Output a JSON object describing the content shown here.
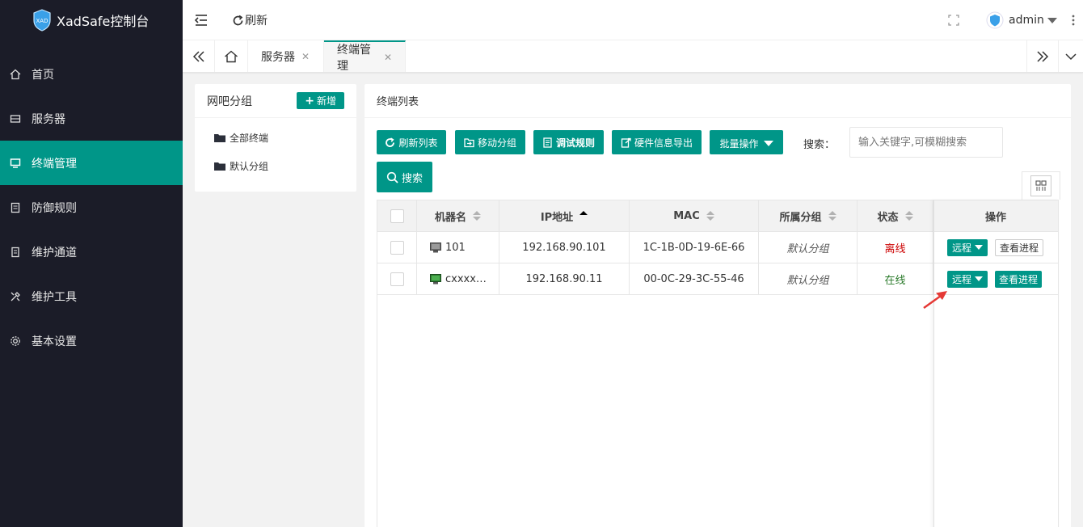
{
  "app": {
    "title": "XadSafe控制台",
    "logo_text": "XAD"
  },
  "sidebar": {
    "items": [
      {
        "label": "首页",
        "icon": "home-icon",
        "active": false
      },
      {
        "label": "服务器",
        "icon": "server-icon",
        "active": false
      },
      {
        "label": "终端管理",
        "icon": "monitor-icon",
        "active": true
      },
      {
        "label": "防御规则",
        "icon": "rules-icon",
        "active": false
      },
      {
        "label": "维护通道",
        "icon": "channel-icon",
        "active": false
      },
      {
        "label": "维护工具",
        "icon": "tools-icon",
        "active": false
      },
      {
        "label": "基本设置",
        "icon": "gear-icon",
        "active": false
      }
    ]
  },
  "header": {
    "refresh_label": "刷新",
    "user": "admin"
  },
  "tabs": {
    "items": [
      {
        "label": "服务器"
      },
      {
        "label": "终端管理",
        "active": true
      }
    ]
  },
  "group_panel": {
    "title": "网吧分组",
    "add_label": "新增",
    "items": [
      "全部终端",
      "默认分组"
    ]
  },
  "terminal_panel": {
    "title": "终端列表",
    "toolbar": {
      "refresh_list": "刷新列表",
      "move_group": "移动分组",
      "debug_rules": "调试规则",
      "export_hw": "硬件信息导出",
      "batch_ops": "批量操作",
      "search_label": "搜索：",
      "search_placeholder": "输入关键字,可模糊搜索",
      "search_button": "搜索"
    },
    "columns": [
      "机器名",
      "IP地址",
      "MAC",
      "所属分组",
      "状态",
      "操作"
    ],
    "rows": [
      {
        "name": "101",
        "ip": "192.168.90.101",
        "mac": "1C-1B-0D-19-6E-66",
        "group": "默认分组",
        "status": "离线",
        "remote": "远程",
        "process": "查看进程"
      },
      {
        "name": "cxxxx…",
        "ip": "192.168.90.11",
        "mac": "00-0C-29-3C-55-46",
        "group": "默认分组",
        "status": "在线",
        "remote": "远程",
        "process": "查看进程"
      }
    ]
  },
  "colors": {
    "accent": "#009688",
    "sidebar_bg": "#1b1c28",
    "offline": "#cc0000",
    "online": "#2a7a2a",
    "arrow": "#e53935"
  }
}
